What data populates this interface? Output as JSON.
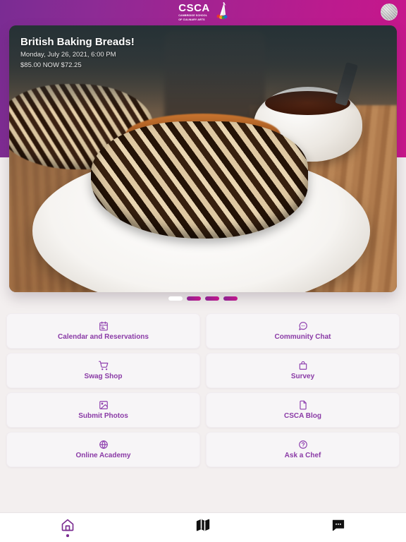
{
  "header": {
    "logo_main": "CSCA",
    "logo_sub_line1": "CAMBRIDGE SCHOOL",
    "logo_sub_line2": "OF CULINARY ARTS",
    "logo_icon": "csca-sail-logo-icon",
    "avatar_icon": "user-avatar",
    "gradient_start": "#7A2C93",
    "gradient_end": "#C9168B"
  },
  "hero": {
    "title": "British Baking Breads!",
    "datetime": "Monday, July 26, 2021, 6:00 PM",
    "price": "$85.00 NOW $72.25",
    "image_alt": "chocolate babka bread on white plate"
  },
  "carousel": {
    "dots": [
      {
        "state": "inactive"
      },
      {
        "state": "active"
      },
      {
        "state": "active"
      },
      {
        "state": "active"
      }
    ],
    "active_color": "#C4178B",
    "inactive_color": "#FFFFFF"
  },
  "menu": {
    "accent_color": "#8A3AA6",
    "tiles": [
      {
        "label": "Calendar and Reservations",
        "icon": "calendar-icon"
      },
      {
        "label": "Community Chat",
        "icon": "chat-bubble-icon"
      },
      {
        "label": "Swag Shop",
        "icon": "shopping-cart-icon"
      },
      {
        "label": "Survey",
        "icon": "bag-icon"
      },
      {
        "label": "Submit Photos",
        "icon": "image-icon"
      },
      {
        "label": "CSCA Blog",
        "icon": "document-icon"
      },
      {
        "label": "Online Academy",
        "icon": "globe-icon"
      },
      {
        "label": "Ask a Chef",
        "icon": "question-circle-icon"
      }
    ]
  },
  "bottom_nav": {
    "active_color": "#7B2D91",
    "items": [
      {
        "icon": "home-icon",
        "active": true
      },
      {
        "icon": "map-icon",
        "active": false
      },
      {
        "icon": "message-icon",
        "active": false
      }
    ]
  }
}
